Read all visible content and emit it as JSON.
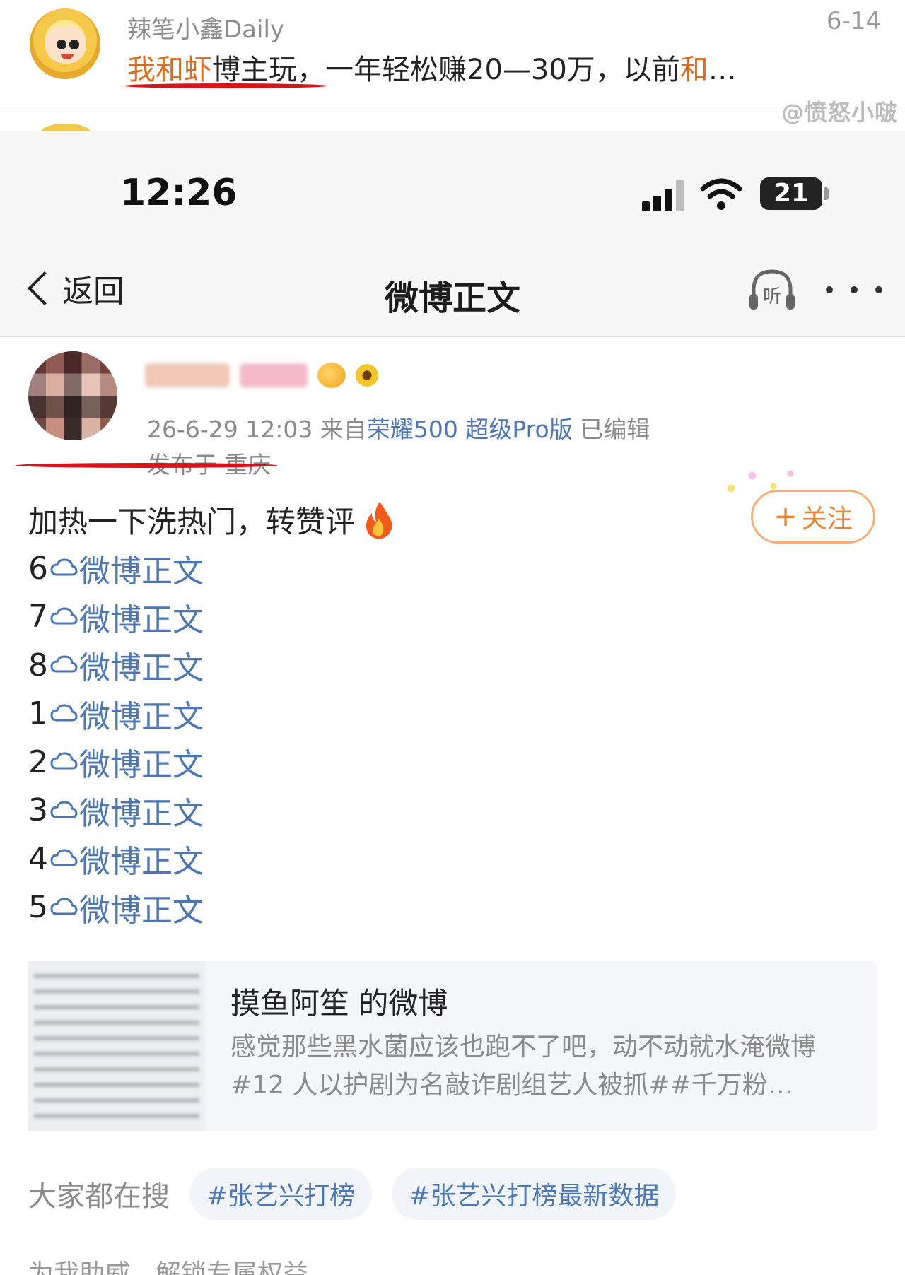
{
  "top": {
    "username": "辣笔小鑫Daily",
    "date": "6-14",
    "text_highlight1": "我和虾",
    "text_mid": "博主玩，一年轻松赚20—30万，以前",
    "text_highlight2": "和",
    "text_tail": "…",
    "watermark": "@愤怒小啵"
  },
  "status_bar": {
    "time": "12:26",
    "battery": "21"
  },
  "nav": {
    "back_label": "返回",
    "title": "微博正文",
    "listen_label": "听"
  },
  "post": {
    "date_time": "26-6-29 12:03",
    "from_prefix": "来自",
    "device": "荣耀500 超级Pro版",
    "edited": "已编辑",
    "location": "发布于 重庆",
    "follow_label": "关注",
    "body_text": "加热一下洗热门，转赞评",
    "links": [
      {
        "num": "6",
        "text": "微博正文"
      },
      {
        "num": "7",
        "text": "微博正文"
      },
      {
        "num": "8",
        "text": "微博正文"
      },
      {
        "num": "1 ",
        "text": "微博正文"
      },
      {
        "num": "2 ",
        "text": "微博正文"
      },
      {
        "num": "3 ",
        "text": "微博正文"
      },
      {
        "num": "4 ",
        "text": "微博正文"
      },
      {
        "num": "5",
        "text": "微博正文"
      }
    ]
  },
  "quote": {
    "title": "摸鱼阿笙 的微博",
    "body": "感觉那些黑水菌应该也跑不了吧，动不动就水淹微博#12 人以护剧为名敲诈剧组艺人被抓##千万粉…"
  },
  "search": {
    "label": "大家都在搜",
    "chips": [
      "#张艺兴打榜",
      "#张艺兴打榜最新数据"
    ]
  },
  "bottom_cut": "为我助威，解锁专属权益",
  "colors": {
    "accent_orange": "#e06b1f",
    "link_blue": "#4c77b4",
    "underline_red": "#d7141a"
  }
}
